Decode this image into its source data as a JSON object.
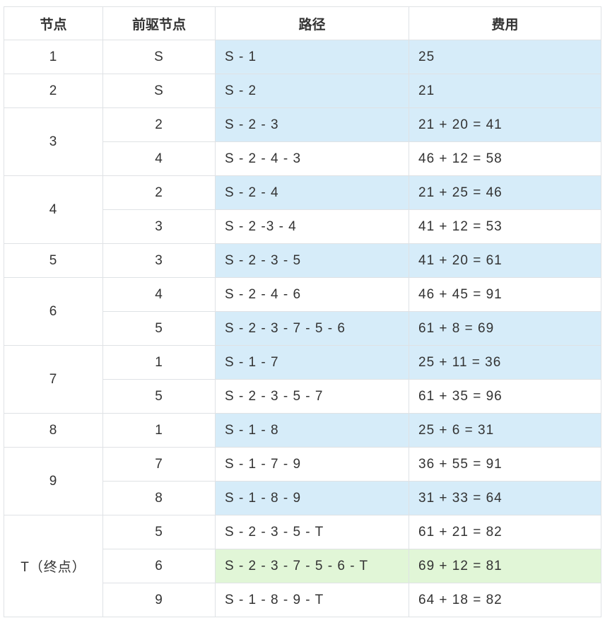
{
  "colors": {
    "highlight_blue": "#d6ecf9",
    "highlight_green": "#e1f6d7",
    "border": "#dfe2e5"
  },
  "headers": {
    "node": "节点",
    "pred": "前驱节点",
    "path": "路径",
    "cost": "费用"
  },
  "nodes": {
    "n1": "1",
    "n2": "2",
    "n3": "3",
    "n4": "4",
    "n5": "5",
    "n6": "6",
    "n7": "7",
    "n8": "8",
    "n9": "9",
    "nT": "T（终点）"
  },
  "rows": [
    {
      "pred": "S",
      "path": "S - 1",
      "cost": "25",
      "highlight": "blue"
    },
    {
      "pred": "S",
      "path": "S - 2",
      "cost": "21",
      "highlight": "blue"
    },
    {
      "pred": "2",
      "path": "S - 2 - 3",
      "cost": "21 + 20 = 41",
      "highlight": "blue"
    },
    {
      "pred": "4",
      "path": "S - 2 - 4 - 3",
      "cost": "46 + 12 = 58",
      "highlight": "none"
    },
    {
      "pred": "2",
      "path": "S - 2 - 4",
      "cost": "21 + 25 = 46",
      "highlight": "blue"
    },
    {
      "pred": "3",
      "path": "S - 2 -3 - 4",
      "cost": "41 + 12 = 53",
      "highlight": "none"
    },
    {
      "pred": "3",
      "path": "S - 2 - 3 - 5",
      "cost": "41 + 20 = 61",
      "highlight": "blue"
    },
    {
      "pred": "4",
      "path": "S - 2 - 4 - 6",
      "cost": "46 + 45 = 91",
      "highlight": "none"
    },
    {
      "pred": "5",
      "path": "S - 2 - 3 - 7 - 5 - 6",
      "cost": "61 + 8 = 69",
      "highlight": "blue"
    },
    {
      "pred": "1",
      "path": "S - 1 - 7",
      "cost": "25 + 11 = 36",
      "highlight": "blue"
    },
    {
      "pred": "5",
      "path": "S - 2 - 3 - 5 - 7",
      "cost": "61 + 35 = 96",
      "highlight": "none"
    },
    {
      "pred": "1",
      "path": "S - 1 - 8",
      "cost": "25 + 6 = 31",
      "highlight": "blue"
    },
    {
      "pred": "7",
      "path": "S - 1 - 7 - 9",
      "cost": "36 + 55 = 91",
      "highlight": "none"
    },
    {
      "pred": "8",
      "path": "S - 1 - 8 - 9",
      "cost": "31 + 33 = 64",
      "highlight": "blue"
    },
    {
      "pred": "5",
      "path": "S - 2 - 3 - 5 - T",
      "cost": "61 + 21 = 82",
      "highlight": "none"
    },
    {
      "pred": "6",
      "path": "S - 2 - 3 - 7 - 5 - 6 - T",
      "cost": "69 + 12 = 81",
      "highlight": "green"
    },
    {
      "pred": "9",
      "path": "S - 1 - 8 - 9 - T",
      "cost": "64 + 18 = 82",
      "highlight": "none"
    }
  ]
}
